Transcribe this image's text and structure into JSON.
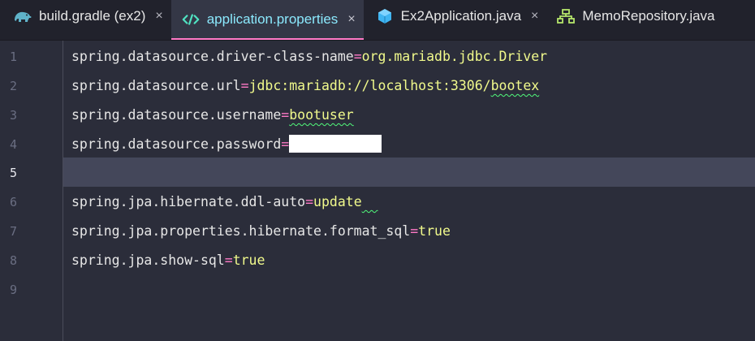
{
  "tabs": [
    {
      "label": "build.gradle (ex2)",
      "icon": "gradle-elephant-icon",
      "active": false,
      "close": "×"
    },
    {
      "label": "application.properties",
      "icon": "code-brackets-icon",
      "active": true,
      "close": "×"
    },
    {
      "label": "Ex2Application.java",
      "icon": "cube-icon",
      "active": false,
      "close": "×"
    },
    {
      "label": "MemoRepository.java",
      "icon": "structure-icon",
      "active": false,
      "close": ""
    }
  ],
  "gutter": {
    "line_numbers": [
      "1",
      "2",
      "3",
      "4",
      "5",
      "6",
      "7",
      "8",
      "9"
    ],
    "current_line": "5"
  },
  "code": {
    "line1": {
      "key": "spring.datasource.driver-class-name",
      "eq": "=",
      "value": "org.mariadb.jdbc.Driver"
    },
    "line2": {
      "key": "spring.datasource.url",
      "eq": "=",
      "value_a": "jdbc:mariadb://localhost:3306/",
      "value_b": "bootex"
    },
    "line3": {
      "key": "spring.datasource.username",
      "eq": "=",
      "value": "bootuser"
    },
    "line4": {
      "key": "spring.datasource.password",
      "eq": "="
    },
    "line6": {
      "key": "spring.jpa.hibernate.ddl-auto",
      "eq": "=",
      "value": "update",
      "trail": "  "
    },
    "line7": {
      "key": "spring.jpa.properties.hibernate.format_sql",
      "eq": "=",
      "value": "true"
    },
    "line8": {
      "key": "spring.jpa.show-sql",
      "eq": "=",
      "value": "true"
    }
  },
  "colors": {
    "background": "#2b2d3a",
    "tabbar": "#21222c",
    "active_tab_text": "#8be9fd",
    "active_tab_underline": "#ff79c6",
    "key_text": "#e6e6e6",
    "equals": "#ff79c6",
    "value_text": "#f1fa8c",
    "spellcheck_squiggle": "#50fa7b",
    "current_line": "#44475a"
  }
}
